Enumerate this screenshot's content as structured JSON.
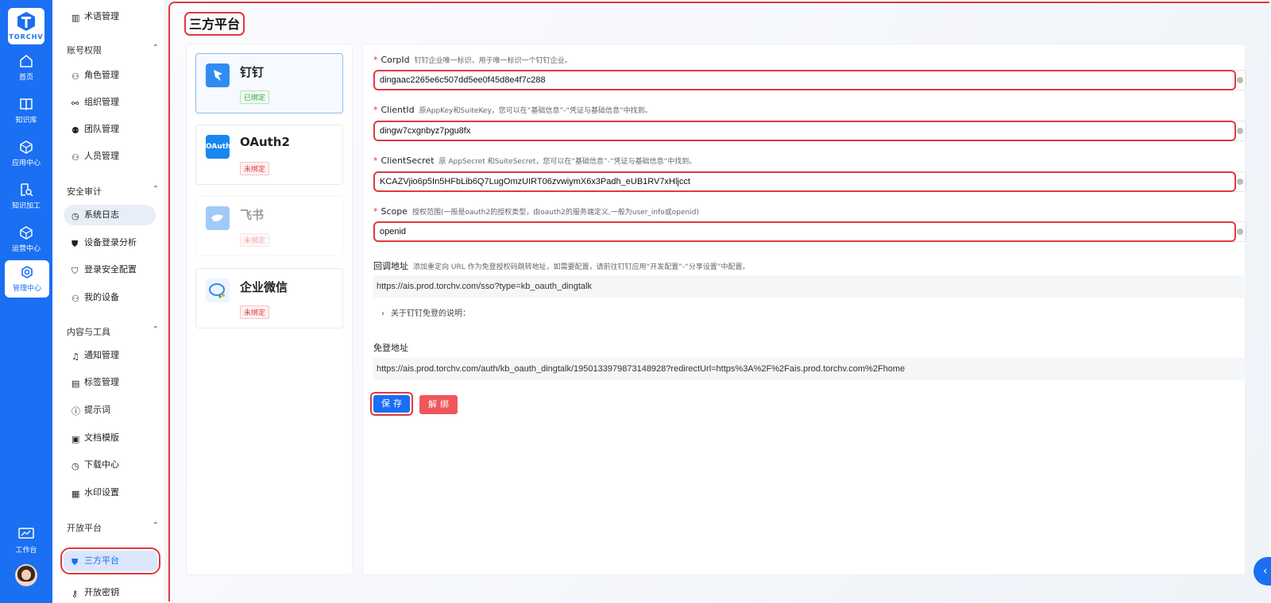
{
  "brand": {
    "logo_text": "TORCHV"
  },
  "rail": [
    {
      "label": "首页"
    },
    {
      "label": "知识库"
    },
    {
      "label": "应用中心"
    },
    {
      "label": "知识加工"
    },
    {
      "label": "运营中心"
    },
    {
      "label": "管理中心"
    },
    {
      "label": "工作台"
    }
  ],
  "sidebar": {
    "top_item": "术语管理",
    "groups": [
      {
        "title": "账号权限",
        "items": [
          "角色管理",
          "组织管理",
          "团队管理",
          "人员管理"
        ]
      },
      {
        "title": "安全审计",
        "items": [
          "系统日志",
          "设备登录分析",
          "登录安全配置",
          "我的设备"
        ]
      },
      {
        "title": "内容与工具",
        "items": [
          "通知管理",
          "标签管理",
          "提示词",
          "文档模版",
          "下载中心",
          "水印设置"
        ]
      },
      {
        "title": "开放平台",
        "items": [
          "三方平台",
          "开放密钥"
        ]
      }
    ]
  },
  "page": {
    "title": "三方平台"
  },
  "platforms": [
    {
      "name": "钉钉",
      "status": "已绑定",
      "icon": "dingtalk-icon",
      "color": "#2f8cf0"
    },
    {
      "name": "OAuth2",
      "status": "未绑定",
      "icon_text": "OAuth",
      "color": "#1a86f0"
    },
    {
      "name": "飞书",
      "status": "未绑定",
      "icon": "feishu-icon",
      "color": "#2f8cf0"
    },
    {
      "name": "企业微信",
      "status": "未绑定",
      "icon": "wecom-icon",
      "color": "#2f8cf0"
    }
  ],
  "form": {
    "corpid": {
      "label": "CorpId",
      "hint": "钉钉企业唯一标识，用于唯一标识一个钉钉企业。",
      "value": "dingaac2265e6c507dd5ee0f45d8e4f7c288"
    },
    "clientid": {
      "label": "ClientId",
      "hint": "原AppKey和SuiteKey，您可以在“基础信息”-“凭证与基础信息”中找到。",
      "value": "dingw7cxgnbyz7pgu8fx"
    },
    "clientsecret": {
      "label": "ClientSecret",
      "hint": "原 AppSecret 和SuiteSecret，您可以在“基础信息”-“凭证与基础信息”中找到。",
      "value": "KCAZVjio6p5In5HFbLib6Q7LugOmzUIRT06zvwiymX6x3Padh_eUB1RV7xHljcct"
    },
    "scope": {
      "label": "Scope",
      "hint": "授权范围(一般是oauth2的授权类型，由oauth2的服务端定义,一般为user_info或openid)",
      "value": "openid"
    },
    "callback": {
      "label": "回调地址",
      "hint": "添加重定向 URL 作为免登授权码跳转地址，如需要配置，请前往钉钉应用“开发配置”-“分享设置”中配置。",
      "value": "https://ais.prod.torchv.com/sso?type=kb_oauth_dingtalk"
    },
    "collapse_label": "关于钉钉免登的说明：",
    "login_url": {
      "label": "免登地址",
      "value": "https://ais.prod.torchv.com/auth/kb_oauth_dingtalk/1950133979873148928?redirectUrl=https%3A%2F%2Fais.prod.torchv.com%2Fhome"
    },
    "save_label": "保存",
    "unbind_label": "解绑"
  }
}
